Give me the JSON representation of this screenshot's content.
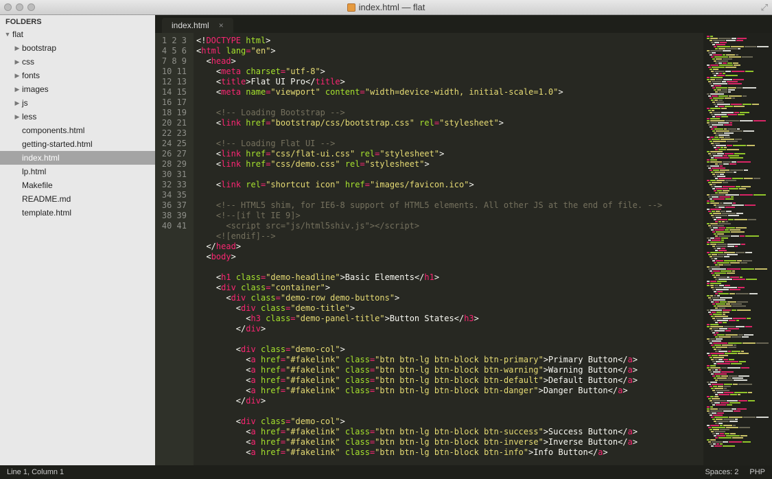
{
  "window": {
    "title": "index.html — flat"
  },
  "sidebar": {
    "heading": "FOLDERS",
    "root": "flat",
    "folders": [
      "bootstrap",
      "css",
      "fonts",
      "images",
      "js",
      "less"
    ],
    "files": [
      "components.html",
      "getting-started.html",
      "index.html",
      "lp.html",
      "Makefile",
      "README.md",
      "template.html"
    ],
    "selected": "index.html"
  },
  "tab": {
    "label": "index.html"
  },
  "gutter": {
    "start": 1,
    "end": 41
  },
  "code": {
    "lines": [
      [
        [
          "br",
          "<!"
        ],
        [
          "t",
          "DOCTYPE"
        ],
        [
          "w",
          " "
        ],
        [
          "a",
          "html"
        ],
        [
          "br",
          ">"
        ]
      ],
      [
        [
          "br",
          "<"
        ],
        [
          "t",
          "html"
        ],
        [
          "w",
          " "
        ],
        [
          "a",
          "lang"
        ],
        [
          "p",
          "="
        ],
        [
          "s",
          "\"en\""
        ],
        [
          "br",
          ">"
        ]
      ],
      [
        [
          "w",
          "  "
        ],
        [
          "br",
          "<"
        ],
        [
          "t",
          "head"
        ],
        [
          "br",
          ">"
        ]
      ],
      [
        [
          "w",
          "    "
        ],
        [
          "br",
          "<"
        ],
        [
          "t",
          "meta"
        ],
        [
          "w",
          " "
        ],
        [
          "a",
          "charset"
        ],
        [
          "p",
          "="
        ],
        [
          "s",
          "\"utf-8\""
        ],
        [
          "br",
          ">"
        ]
      ],
      [
        [
          "w",
          "    "
        ],
        [
          "br",
          "<"
        ],
        [
          "t",
          "title"
        ],
        [
          "br",
          ">"
        ],
        [
          "w",
          "Flat UI Pro"
        ],
        [
          "br",
          "</"
        ],
        [
          "t",
          "title"
        ],
        [
          "br",
          ">"
        ]
      ],
      [
        [
          "w",
          "    "
        ],
        [
          "br",
          "<"
        ],
        [
          "t",
          "meta"
        ],
        [
          "w",
          " "
        ],
        [
          "a",
          "name"
        ],
        [
          "p",
          "="
        ],
        [
          "s",
          "\"viewport\""
        ],
        [
          "w",
          " "
        ],
        [
          "a",
          "content"
        ],
        [
          "p",
          "="
        ],
        [
          "s",
          "\"width=device-width, initial-scale=1.0\""
        ],
        [
          "br",
          ">"
        ]
      ],
      [],
      [
        [
          "w",
          "    "
        ],
        [
          "c",
          "<!-- Loading Bootstrap -->"
        ]
      ],
      [
        [
          "w",
          "    "
        ],
        [
          "br",
          "<"
        ],
        [
          "t",
          "link"
        ],
        [
          "w",
          " "
        ],
        [
          "a",
          "href"
        ],
        [
          "p",
          "="
        ],
        [
          "s",
          "\"bootstrap/css/bootstrap.css\""
        ],
        [
          "w",
          " "
        ],
        [
          "a",
          "rel"
        ],
        [
          "p",
          "="
        ],
        [
          "s",
          "\"stylesheet\""
        ],
        [
          "br",
          ">"
        ]
      ],
      [],
      [
        [
          "w",
          "    "
        ],
        [
          "c",
          "<!-- Loading Flat UI -->"
        ]
      ],
      [
        [
          "w",
          "    "
        ],
        [
          "br",
          "<"
        ],
        [
          "t",
          "link"
        ],
        [
          "w",
          " "
        ],
        [
          "a",
          "href"
        ],
        [
          "p",
          "="
        ],
        [
          "s",
          "\"css/flat-ui.css\""
        ],
        [
          "w",
          " "
        ],
        [
          "a",
          "rel"
        ],
        [
          "p",
          "="
        ],
        [
          "s",
          "\"stylesheet\""
        ],
        [
          "br",
          ">"
        ]
      ],
      [
        [
          "w",
          "    "
        ],
        [
          "br",
          "<"
        ],
        [
          "t",
          "link"
        ],
        [
          "w",
          " "
        ],
        [
          "a",
          "href"
        ],
        [
          "p",
          "="
        ],
        [
          "s",
          "\"css/demo.css\""
        ],
        [
          "w",
          " "
        ],
        [
          "a",
          "rel"
        ],
        [
          "p",
          "="
        ],
        [
          "s",
          "\"stylesheet\""
        ],
        [
          "br",
          ">"
        ]
      ],
      [],
      [
        [
          "w",
          "    "
        ],
        [
          "br",
          "<"
        ],
        [
          "t",
          "link"
        ],
        [
          "w",
          " "
        ],
        [
          "a",
          "rel"
        ],
        [
          "p",
          "="
        ],
        [
          "s",
          "\"shortcut icon\""
        ],
        [
          "w",
          " "
        ],
        [
          "a",
          "href"
        ],
        [
          "p",
          "="
        ],
        [
          "s",
          "\"images/favicon.ico\""
        ],
        [
          "br",
          ">"
        ]
      ],
      [],
      [
        [
          "w",
          "    "
        ],
        [
          "c",
          "<!-- HTML5 shim, for IE6-8 support of HTML5 elements. All other JS at the end of file. -->"
        ]
      ],
      [
        [
          "w",
          "    "
        ],
        [
          "c",
          "<!--[if lt IE 9]>"
        ]
      ],
      [
        [
          "w",
          "      "
        ],
        [
          "c",
          "<script src=\"js/html5shiv.js\"></script>"
        ]
      ],
      [
        [
          "w",
          "    "
        ],
        [
          "c",
          "<![endif]-->"
        ]
      ],
      [
        [
          "w",
          "  "
        ],
        [
          "br",
          "</"
        ],
        [
          "t",
          "head"
        ],
        [
          "br",
          ">"
        ]
      ],
      [
        [
          "w",
          "  "
        ],
        [
          "br",
          "<"
        ],
        [
          "t",
          "body"
        ],
        [
          "br",
          ">"
        ]
      ],
      [],
      [
        [
          "w",
          "    "
        ],
        [
          "br",
          "<"
        ],
        [
          "t",
          "h1"
        ],
        [
          "w",
          " "
        ],
        [
          "a",
          "class"
        ],
        [
          "p",
          "="
        ],
        [
          "s",
          "\"demo-headline\""
        ],
        [
          "br",
          ">"
        ],
        [
          "w",
          "Basic Elements"
        ],
        [
          "br",
          "</"
        ],
        [
          "t",
          "h1"
        ],
        [
          "br",
          ">"
        ]
      ],
      [
        [
          "w",
          "    "
        ],
        [
          "br",
          "<"
        ],
        [
          "t",
          "div"
        ],
        [
          "w",
          " "
        ],
        [
          "a",
          "class"
        ],
        [
          "p",
          "="
        ],
        [
          "s",
          "\"container\""
        ],
        [
          "br",
          ">"
        ]
      ],
      [
        [
          "w",
          "      "
        ],
        [
          "br",
          "<"
        ],
        [
          "t",
          "div"
        ],
        [
          "w",
          " "
        ],
        [
          "a",
          "class"
        ],
        [
          "p",
          "="
        ],
        [
          "s",
          "\"demo-row demo-buttons\""
        ],
        [
          "br",
          ">"
        ]
      ],
      [
        [
          "w",
          "        "
        ],
        [
          "br",
          "<"
        ],
        [
          "t",
          "div"
        ],
        [
          "w",
          " "
        ],
        [
          "a",
          "class"
        ],
        [
          "p",
          "="
        ],
        [
          "s",
          "\"demo-title\""
        ],
        [
          "br",
          ">"
        ]
      ],
      [
        [
          "w",
          "          "
        ],
        [
          "br",
          "<"
        ],
        [
          "t",
          "h3"
        ],
        [
          "w",
          " "
        ],
        [
          "a",
          "class"
        ],
        [
          "p",
          "="
        ],
        [
          "s",
          "\"demo-panel-title\""
        ],
        [
          "br",
          ">"
        ],
        [
          "w",
          "Button States"
        ],
        [
          "br",
          "</"
        ],
        [
          "t",
          "h3"
        ],
        [
          "br",
          ">"
        ]
      ],
      [
        [
          "w",
          "        "
        ],
        [
          "br",
          "</"
        ],
        [
          "t",
          "div"
        ],
        [
          "br",
          ">"
        ]
      ],
      [],
      [
        [
          "w",
          "        "
        ],
        [
          "br",
          "<"
        ],
        [
          "t",
          "div"
        ],
        [
          "w",
          " "
        ],
        [
          "a",
          "class"
        ],
        [
          "p",
          "="
        ],
        [
          "s",
          "\"demo-col\""
        ],
        [
          "br",
          ">"
        ]
      ],
      [
        [
          "w",
          "          "
        ],
        [
          "br",
          "<"
        ],
        [
          "t",
          "a"
        ],
        [
          "w",
          " "
        ],
        [
          "a",
          "href"
        ],
        [
          "p",
          "="
        ],
        [
          "s",
          "\"#fakelink\""
        ],
        [
          "w",
          " "
        ],
        [
          "a",
          "class"
        ],
        [
          "p",
          "="
        ],
        [
          "s",
          "\"btn btn-lg btn-block btn-primary\""
        ],
        [
          "br",
          ">"
        ],
        [
          "w",
          "Primary Button"
        ],
        [
          "br",
          "</"
        ],
        [
          "t",
          "a"
        ],
        [
          "br",
          ">"
        ]
      ],
      [
        [
          "w",
          "          "
        ],
        [
          "br",
          "<"
        ],
        [
          "t",
          "a"
        ],
        [
          "w",
          " "
        ],
        [
          "a",
          "href"
        ],
        [
          "p",
          "="
        ],
        [
          "s",
          "\"#fakelink\""
        ],
        [
          "w",
          " "
        ],
        [
          "a",
          "class"
        ],
        [
          "p",
          "="
        ],
        [
          "s",
          "\"btn btn-lg btn-block btn-warning\""
        ],
        [
          "br",
          ">"
        ],
        [
          "w",
          "Warning Button"
        ],
        [
          "br",
          "</"
        ],
        [
          "t",
          "a"
        ],
        [
          "br",
          ">"
        ]
      ],
      [
        [
          "w",
          "          "
        ],
        [
          "br",
          "<"
        ],
        [
          "t",
          "a"
        ],
        [
          "w",
          " "
        ],
        [
          "a",
          "href"
        ],
        [
          "p",
          "="
        ],
        [
          "s",
          "\"#fakelink\""
        ],
        [
          "w",
          " "
        ],
        [
          "a",
          "class"
        ],
        [
          "p",
          "="
        ],
        [
          "s",
          "\"btn btn-lg btn-block btn-default\""
        ],
        [
          "br",
          ">"
        ],
        [
          "w",
          "Default Button"
        ],
        [
          "br",
          "</"
        ],
        [
          "t",
          "a"
        ],
        [
          "br",
          ">"
        ]
      ],
      [
        [
          "w",
          "          "
        ],
        [
          "br",
          "<"
        ],
        [
          "t",
          "a"
        ],
        [
          "w",
          " "
        ],
        [
          "a",
          "href"
        ],
        [
          "p",
          "="
        ],
        [
          "s",
          "\"#fakelink\""
        ],
        [
          "w",
          " "
        ],
        [
          "a",
          "class"
        ],
        [
          "p",
          "="
        ],
        [
          "s",
          "\"btn btn-lg btn-block btn-danger\""
        ],
        [
          "br",
          ">"
        ],
        [
          "w",
          "Danger Button"
        ],
        [
          "br",
          "</"
        ],
        [
          "t",
          "a"
        ],
        [
          "br",
          ">"
        ]
      ],
      [
        [
          "w",
          "        "
        ],
        [
          "br",
          "</"
        ],
        [
          "t",
          "div"
        ],
        [
          "br",
          ">"
        ]
      ],
      [],
      [
        [
          "w",
          "        "
        ],
        [
          "br",
          "<"
        ],
        [
          "t",
          "div"
        ],
        [
          "w",
          " "
        ],
        [
          "a",
          "class"
        ],
        [
          "p",
          "="
        ],
        [
          "s",
          "\"demo-col\""
        ],
        [
          "br",
          ">"
        ]
      ],
      [
        [
          "w",
          "          "
        ],
        [
          "br",
          "<"
        ],
        [
          "t",
          "a"
        ],
        [
          "w",
          " "
        ],
        [
          "a",
          "href"
        ],
        [
          "p",
          "="
        ],
        [
          "s",
          "\"#fakelink\""
        ],
        [
          "w",
          " "
        ],
        [
          "a",
          "class"
        ],
        [
          "p",
          "="
        ],
        [
          "s",
          "\"btn btn-lg btn-block btn-success\""
        ],
        [
          "br",
          ">"
        ],
        [
          "w",
          "Success Button"
        ],
        [
          "br",
          "</"
        ],
        [
          "t",
          "a"
        ],
        [
          "br",
          ">"
        ]
      ],
      [
        [
          "w",
          "          "
        ],
        [
          "br",
          "<"
        ],
        [
          "t",
          "a"
        ],
        [
          "w",
          " "
        ],
        [
          "a",
          "href"
        ],
        [
          "p",
          "="
        ],
        [
          "s",
          "\"#fakelink\""
        ],
        [
          "w",
          " "
        ],
        [
          "a",
          "class"
        ],
        [
          "p",
          "="
        ],
        [
          "s",
          "\"btn btn-lg btn-block btn-inverse\""
        ],
        [
          "br",
          ">"
        ],
        [
          "w",
          "Inverse Button"
        ],
        [
          "br",
          "</"
        ],
        [
          "t",
          "a"
        ],
        [
          "br",
          ">"
        ]
      ],
      [
        [
          "w",
          "          "
        ],
        [
          "br",
          "<"
        ],
        [
          "t",
          "a"
        ],
        [
          "w",
          " "
        ],
        [
          "a",
          "href"
        ],
        [
          "p",
          "="
        ],
        [
          "s",
          "\"#fakelink\""
        ],
        [
          "w",
          " "
        ],
        [
          "a",
          "class"
        ],
        [
          "p",
          "="
        ],
        [
          "s",
          "\"btn btn-lg btn-block btn-info\""
        ],
        [
          "br",
          ">"
        ],
        [
          "w",
          "Info Button"
        ],
        [
          "br",
          "</"
        ],
        [
          "t",
          "a"
        ],
        [
          "br",
          ">"
        ]
      ]
    ]
  },
  "status": {
    "left": "Line 1, Column 1",
    "spaces": "Spaces: 2",
    "syntax": "PHP"
  }
}
